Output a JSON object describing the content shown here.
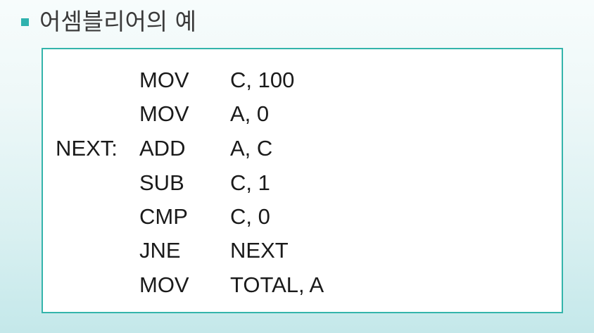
{
  "title": {
    "text": "어셈블리어의 예"
  },
  "code": {
    "lines": [
      {
        "label": "",
        "opcode": "MOV",
        "operand": "C, 100"
      },
      {
        "label": "",
        "opcode": "MOV",
        "operand": "A, 0"
      },
      {
        "label": "NEXT:",
        "opcode": "ADD",
        "operand": "A, C"
      },
      {
        "label": "",
        "opcode": "SUB",
        "operand": "C, 1"
      },
      {
        "label": "",
        "opcode": "CMP",
        "operand": "C, 0"
      },
      {
        "label": "",
        "opcode": "JNE",
        "operand": "NEXT"
      },
      {
        "label": "",
        "opcode": "MOV",
        "operand": "TOTAL, A"
      }
    ]
  },
  "colors": {
    "accent": "#34b4ab",
    "bullet": "#2fb2ae",
    "text": "#1a1a1a",
    "title_text": "#3a3a3a"
  }
}
